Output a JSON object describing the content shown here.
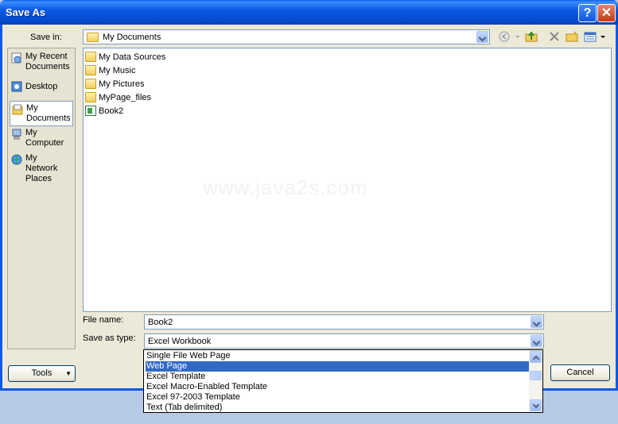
{
  "window": {
    "title": "Save As"
  },
  "titlebar": {
    "help_glyph": "?",
    "close_glyph": "✕"
  },
  "save_in": {
    "label": "Save in:",
    "value": "My Documents"
  },
  "places": [
    {
      "label": "My Recent Documents",
      "icon": "recent-documents-icon"
    },
    {
      "label": "Desktop",
      "icon": "desktop-icon"
    },
    {
      "label": "My Documents",
      "icon": "my-documents-icon",
      "selected": true
    },
    {
      "label": "My Computer",
      "icon": "my-computer-icon"
    },
    {
      "label": "My Network Places",
      "icon": "network-places-icon"
    }
  ],
  "files": [
    {
      "name": "My Data Sources",
      "icon": "folder-icon"
    },
    {
      "name": "My Music",
      "icon": "folder-icon"
    },
    {
      "name": "My Pictures",
      "icon": "folder-icon"
    },
    {
      "name": "MyPage_files",
      "icon": "folder-icon"
    },
    {
      "name": "Book2",
      "icon": "excel-file-icon"
    }
  ],
  "watermark": "www.java2s.com",
  "file_name": {
    "label": "File name:",
    "value": "Book2"
  },
  "save_as_type": {
    "label": "Save as type:",
    "value": "Excel Workbook",
    "options": [
      "Single File Web Page",
      "Web Page",
      "Excel Template",
      "Excel Macro-Enabled Template",
      "Excel 97-2003 Template",
      "Text (Tab delimited)"
    ],
    "selected": "Web Page"
  },
  "buttons": {
    "tools": "Tools",
    "cancel": "Cancel"
  },
  "colors": {
    "titlebar": "#0a5ae8",
    "selection": "#316ac5",
    "dialog_bg": "#ece9d8"
  }
}
